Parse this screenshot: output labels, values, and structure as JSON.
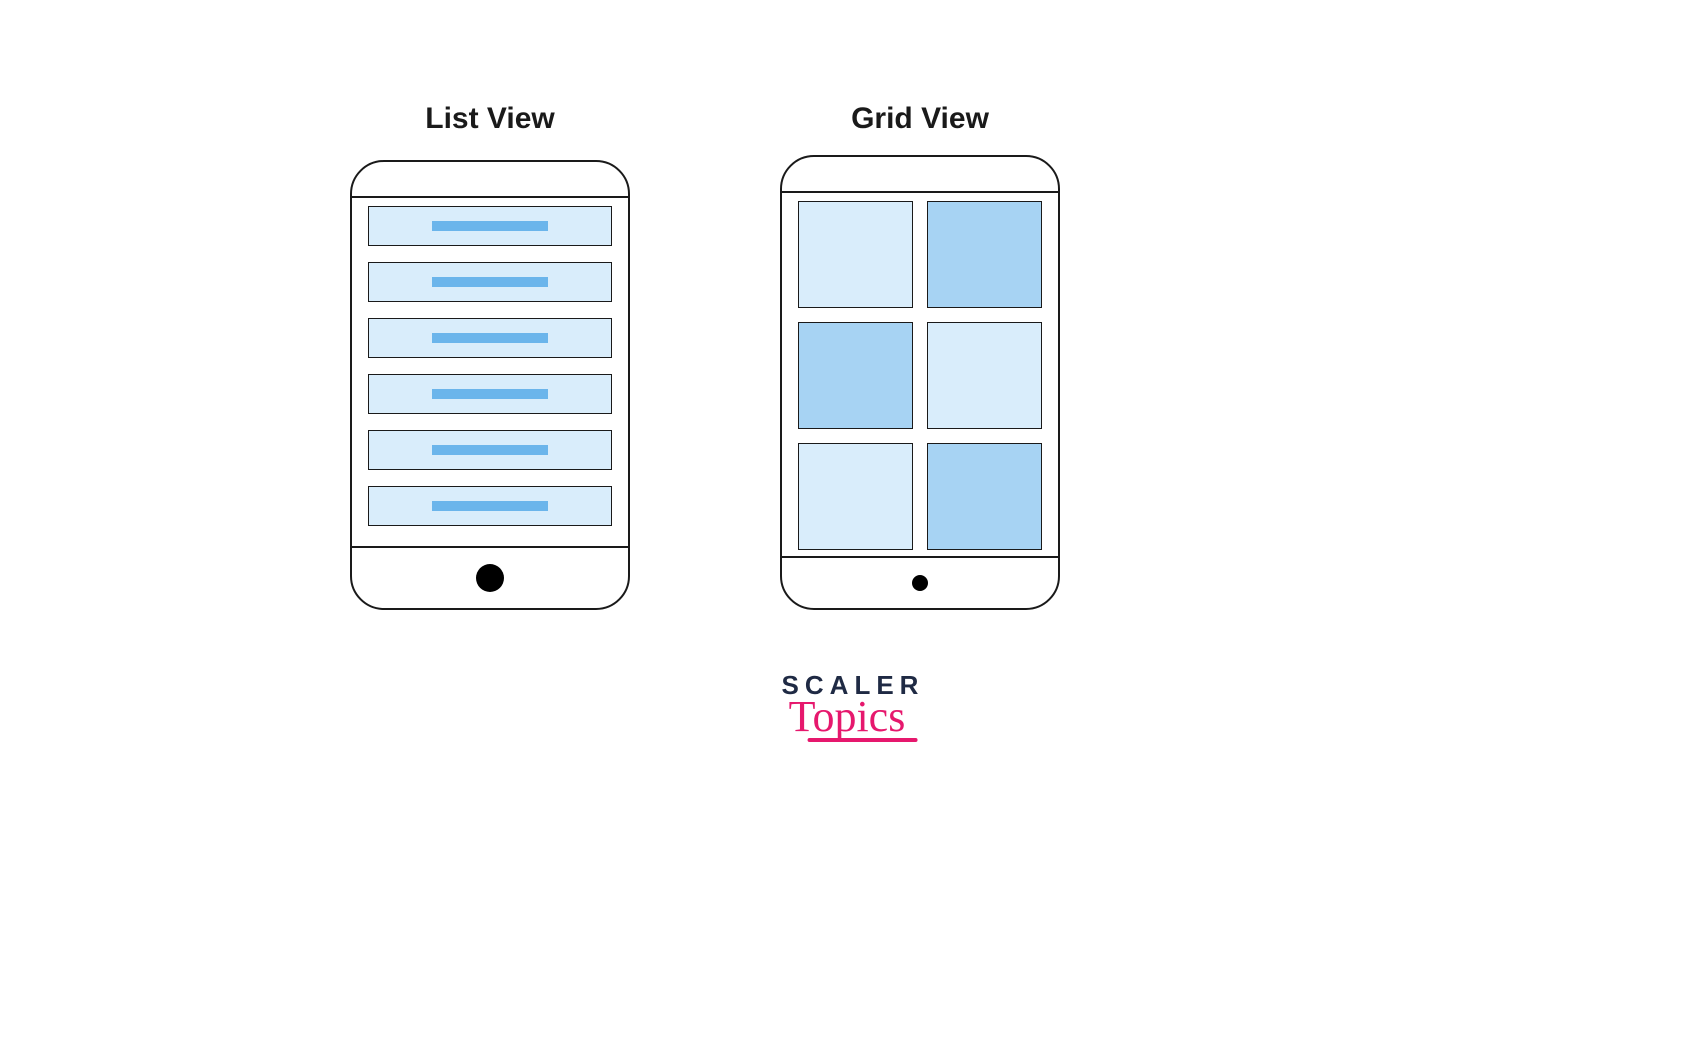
{
  "labels": {
    "left_heading": "List View",
    "right_heading": "Grid View"
  },
  "brand": {
    "line1": "SCALER",
    "line2": "Topics"
  },
  "list_view": {
    "row_count": 6,
    "row_fill": "#d9edfb",
    "bar_fill": "#6bb5eb"
  },
  "grid_view": {
    "rows": 3,
    "cols": 2,
    "tiles": [
      {
        "shade": "pale"
      },
      {
        "shade": "mid"
      },
      {
        "shade": "mid"
      },
      {
        "shade": "pale"
      },
      {
        "shade": "pale"
      },
      {
        "shade": "mid"
      }
    ],
    "pale_fill": "#d9edfb",
    "mid_fill": "#a7d3f3"
  }
}
